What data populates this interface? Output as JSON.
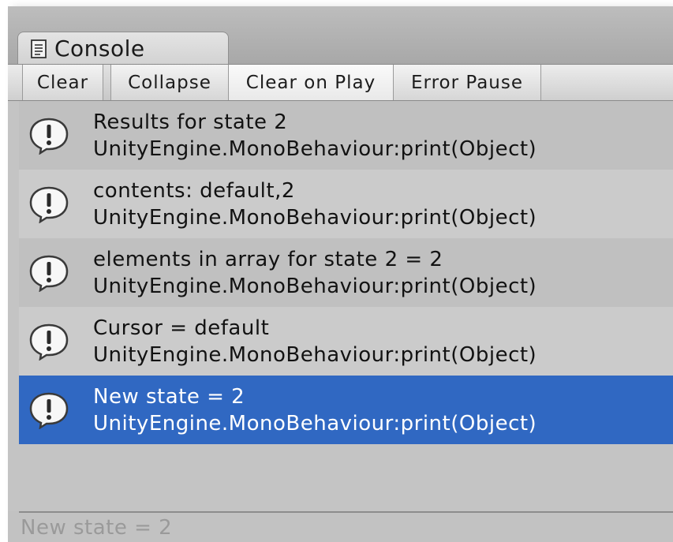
{
  "window": {
    "tab_title": "Console",
    "tab_icon": "console-document-icon"
  },
  "toolbar": {
    "buttons": [
      {
        "label": "Clear",
        "active": false
      },
      {
        "label": "Collapse",
        "active": false
      },
      {
        "label": "Clear on Play",
        "active": true
      },
      {
        "label": "Error Pause",
        "active": false
      }
    ]
  },
  "log": {
    "entry_icon": "info-exclamation-icon",
    "selected_color": "#3068c2",
    "entries": [
      {
        "message": "Results for state 2",
        "trace": "UnityEngine.MonoBehaviour:print(Object)",
        "selected": false
      },
      {
        "message": "contents: default,2",
        "trace": "UnityEngine.MonoBehaviour:print(Object)",
        "selected": false
      },
      {
        "message": "elements in array for state 2 = 2",
        "trace": "UnityEngine.MonoBehaviour:print(Object)",
        "selected": false
      },
      {
        "message": "Cursor = default",
        "trace": "UnityEngine.MonoBehaviour:print(Object)",
        "selected": false
      },
      {
        "message": "New state = 2",
        "trace": "UnityEngine.MonoBehaviour:print(Object)",
        "selected": true
      }
    ]
  },
  "status_bar": {
    "text": "New state = 2"
  }
}
